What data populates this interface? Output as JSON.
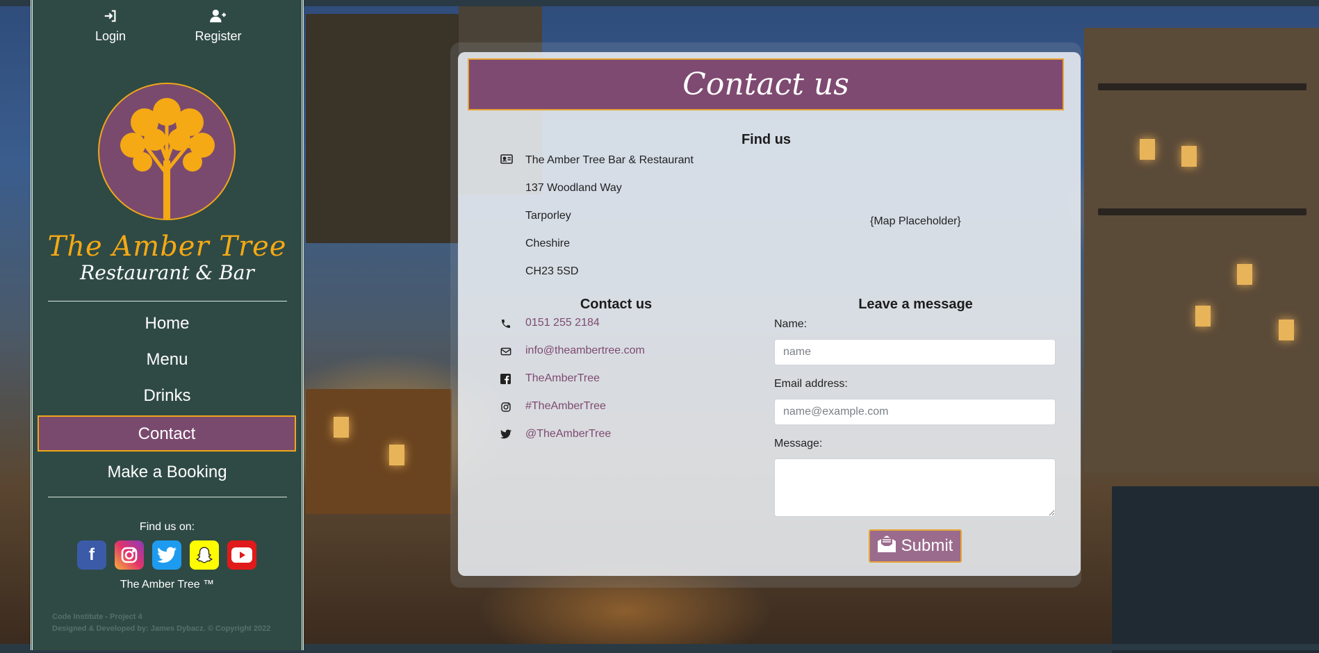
{
  "auth": {
    "login_label": "Login",
    "register_label": "Register"
  },
  "brand": {
    "name": "The Amber Tree",
    "tagline": "Restaurant & Bar"
  },
  "nav": {
    "items": [
      {
        "label": "Home"
      },
      {
        "label": "Menu"
      },
      {
        "label": "Drinks"
      },
      {
        "label": "Contact",
        "active": true
      },
      {
        "label": "Make a Booking"
      }
    ]
  },
  "sidebar_footer": {
    "find_us_on": "Find us on:",
    "social_icons": [
      "facebook-icon",
      "instagram-icon",
      "twitter-icon",
      "snapchat-icon",
      "youtube-icon"
    ],
    "trademark": "The Amber Tree ™",
    "credit_line_1": "Code Institute - Project 4",
    "credit_line_2": "Designed & Developed by: James Dybacz. © Copyright 2022"
  },
  "page": {
    "title": "Contact us"
  },
  "find_us": {
    "heading": "Find us",
    "address": [
      "The Amber Tree Bar & Restaurant",
      "137 Woodland Way",
      "Tarporley",
      "Cheshire",
      "CH23 5SD"
    ],
    "map_placeholder": "{Map Placeholder}"
  },
  "contact": {
    "heading": "Contact us",
    "phone": "0151 255 2184",
    "email": "info@theambertree.com",
    "facebook": "TheAmberTree",
    "instagram": "#TheAmberTree",
    "twitter": "@TheAmberTree"
  },
  "message_form": {
    "heading": "Leave a message",
    "name_label": "Name:",
    "name_placeholder": "name",
    "email_label": "Email address:",
    "email_placeholder": "name@example.com",
    "message_label": "Message:",
    "submit_label": "Submit"
  },
  "colors": {
    "sidebar_bg": "#2f4a44",
    "accent_purple": "#7e4a71",
    "accent_amber": "#f5a914",
    "link_color": "#7e4a71"
  }
}
